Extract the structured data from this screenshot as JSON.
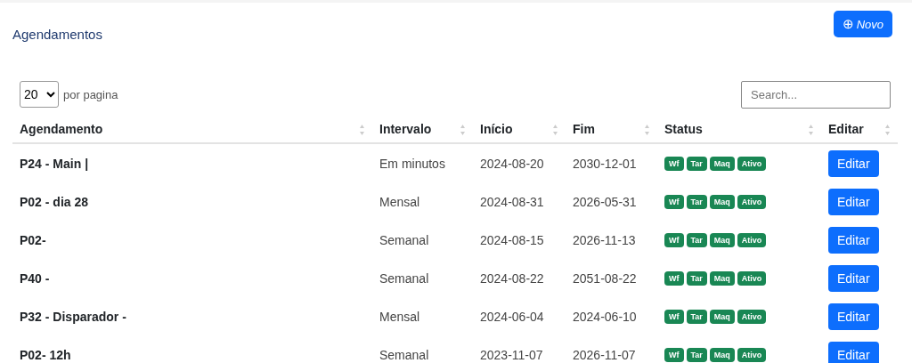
{
  "title": "Agendamentos",
  "new_button": {
    "icon": "⊕",
    "label": "Novo"
  },
  "page_size": {
    "value": "20",
    "label": "por pagina"
  },
  "search": {
    "placeholder": "Search..."
  },
  "columns": [
    "Agendamento",
    "Intervalo",
    "Início",
    "Fim",
    "Status",
    "Editar"
  ],
  "rows": [
    {
      "name": "P24 - Main |",
      "interval": "Em minutos",
      "start": "2024-08-20",
      "end": "2030-12-01",
      "badges": [
        "Wf",
        "Tar",
        "Maq",
        "Ativo"
      ],
      "action": "Editar"
    },
    {
      "name": "P02 - dia 28",
      "interval": "Mensal",
      "start": "2024-08-31",
      "end": "2026-05-31",
      "badges": [
        "Wf",
        "Tar",
        "Maq",
        "Ativo"
      ],
      "action": "Editar"
    },
    {
      "name": "P02-",
      "interval": "Semanal",
      "start": "2024-08-15",
      "end": "2026-11-13",
      "badges": [
        "Wf",
        "Tar",
        "Maq",
        "Ativo"
      ],
      "action": "Editar"
    },
    {
      "name": "P40 -",
      "interval": "Semanal",
      "start": "2024-08-22",
      "end": "2051-08-22",
      "badges": [
        "Wf",
        "Tar",
        "Maq",
        "Ativo"
      ],
      "action": "Editar"
    },
    {
      "name": "P32 - Disparador -",
      "interval": "Mensal",
      "start": "2024-06-04",
      "end": "2024-06-10",
      "badges": [
        "Wf",
        "Tar",
        "Maq",
        "Ativo"
      ],
      "action": "Editar"
    },
    {
      "name": "P02- 12h",
      "interval": "Semanal",
      "start": "2023-11-07",
      "end": "2026-11-07",
      "badges": [
        "Wf",
        "Tar",
        "Maq",
        "Ativo"
      ],
      "action": "Editar"
    }
  ]
}
